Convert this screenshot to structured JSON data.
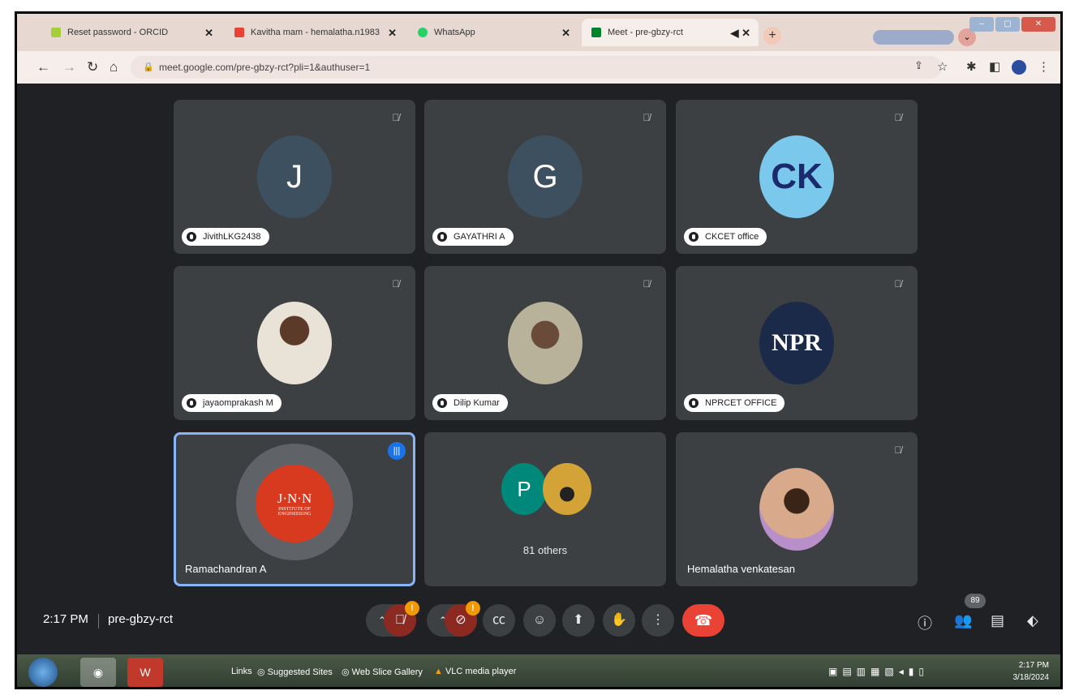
{
  "browser": {
    "tabs": [
      {
        "title": "Reset password - ORCID",
        "favicon_color": "#a6ce39",
        "active": false
      },
      {
        "title": "Kavitha mam - hemalatha.n1983",
        "favicon_color": "#ea4335",
        "active": false
      },
      {
        "title": "WhatsApp",
        "favicon_color": "#25d366",
        "active": false
      },
      {
        "title": "Meet - pre-gbzy-rct",
        "favicon_color": "#00832d",
        "active": true
      }
    ],
    "new_tab": "+",
    "url": "meet.google.com/pre-gbzy-rct?pli=1&authuser=1"
  },
  "meet": {
    "tiles": [
      {
        "name": "JivithLKG2438",
        "initial": "J",
        "avatar_color": "#3d5060",
        "type": "initial"
      },
      {
        "name": "GAYATHRI A",
        "initial": "G",
        "avatar_color": "#3d5060",
        "type": "initial"
      },
      {
        "name": "CKCET office",
        "initial": "CK",
        "avatar_color": "#7ac8ec",
        "type": "logo"
      },
      {
        "name": "jayaomprakash M",
        "type": "photo"
      },
      {
        "name": "Dilip Kumar",
        "type": "photo"
      },
      {
        "name": "NPRCET OFFICE",
        "logo_text": "NPR",
        "type": "logo"
      },
      {
        "name": "Ramachandran A",
        "logo_text": "J·N·N",
        "logo_sub": "INSTITUTE OF ENGINEERING",
        "type": "speaking"
      },
      {
        "others_label": "81 others",
        "initial": "P",
        "avatar_color": "#00897b",
        "type": "others"
      },
      {
        "name": "Hemalatha venkatesan",
        "type": "photo"
      }
    ],
    "time": "2:17 PM",
    "meeting_code": "pre-gbzy-rct",
    "participant_count": "89",
    "alert_badge": "!"
  },
  "taskbar": {
    "links_label": "Links",
    "links": [
      "Suggested Sites",
      "Web Slice Gallery",
      "VLC media player"
    ],
    "clock_time": "2:17 PM",
    "clock_date": "3/18/2024"
  }
}
